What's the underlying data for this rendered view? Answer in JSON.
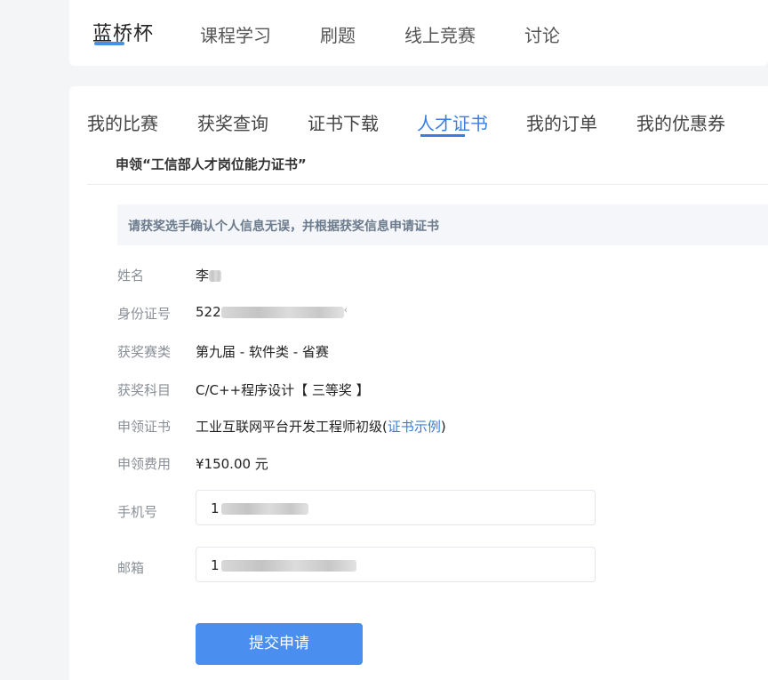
{
  "header": {
    "logo": "蓝桥杯",
    "nav": [
      "课程学习",
      "刷题",
      "线上竞赛",
      "讨论"
    ]
  },
  "tabs": [
    "我的比赛",
    "获奖查询",
    "证书下载",
    "人才证书",
    "我的订单",
    "我的优惠券"
  ],
  "active_tab": "人才证书",
  "section_title": "申领“工信部人才岗位能力证书”",
  "notice": "请获奖选手确认个人信息无误，并根据获奖信息申请证书",
  "fields": {
    "name_label": "姓名",
    "name_value": "李",
    "id_label": "身份证号",
    "id_value": "522",
    "id_tail": "‹",
    "category_label": "获奖赛类",
    "category_value": "第九届 - 软件类 - 省赛",
    "subject_label": "获奖科目",
    "subject_value": "C/C++程序设计【 三等奖 】",
    "cert_label": "申领证书",
    "cert_value": "工业互联网平台开发工程师初级(",
    "cert_link": "证书示例",
    "cert_close": ")",
    "fee_label": "申领费用",
    "fee_value": "¥150.00 元",
    "phone_label": "手机号",
    "phone_value": "1",
    "email_label": "邮箱",
    "email_value": "1"
  },
  "submit_label": "提交申请",
  "colors": {
    "accent": "#3a7de0",
    "button": "#4a8ff0"
  }
}
